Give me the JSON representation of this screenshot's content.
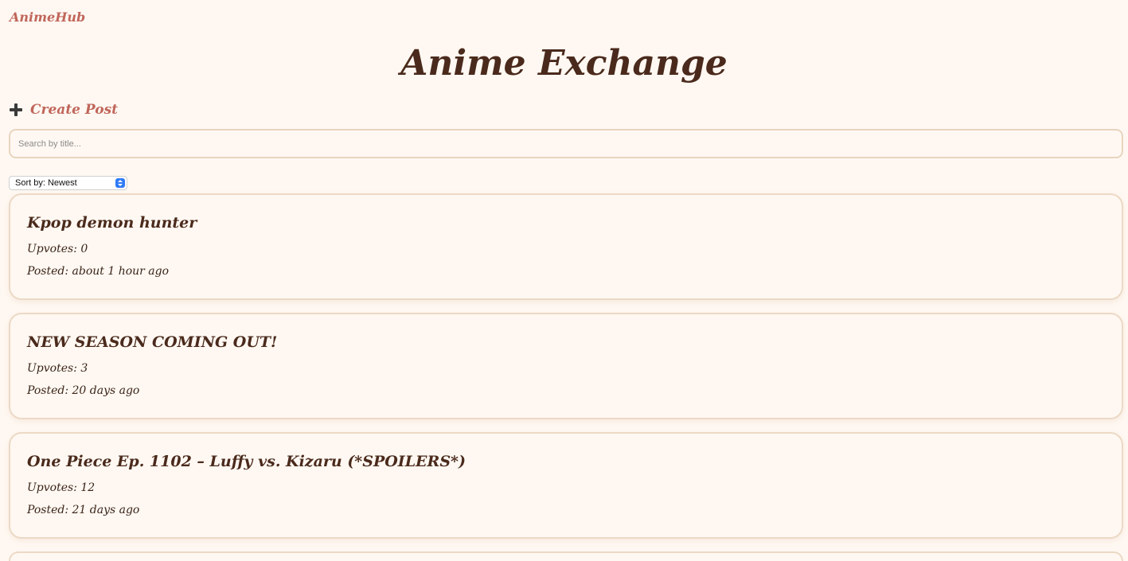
{
  "nav": {
    "brand": "AnimeHub"
  },
  "header": {
    "title": "Anime Exchange"
  },
  "actions": {
    "create_post_label": "Create Post"
  },
  "search": {
    "placeholder": "Search by title...",
    "value": ""
  },
  "sort": {
    "selected": "Sort by: Newest"
  },
  "posts": [
    {
      "title": "Kpop demon hunter",
      "upvotes": "Upvotes: 0",
      "posted": "Posted: about 1 hour ago"
    },
    {
      "title": "NEW SEASON COMING OUT!",
      "upvotes": "Upvotes: 3",
      "posted": "Posted: 20 days ago"
    },
    {
      "title": "One Piece Ep. 1102 – Luffy vs. Kizaru (*SPOILERS*)",
      "upvotes": "Upvotes: 12",
      "posted": "Posted: 21 days ago"
    }
  ],
  "colors": {
    "background": "#fff8f2",
    "accent": "#c0665a",
    "heading": "#4a2a1c",
    "card_border": "#ecd9c5"
  }
}
